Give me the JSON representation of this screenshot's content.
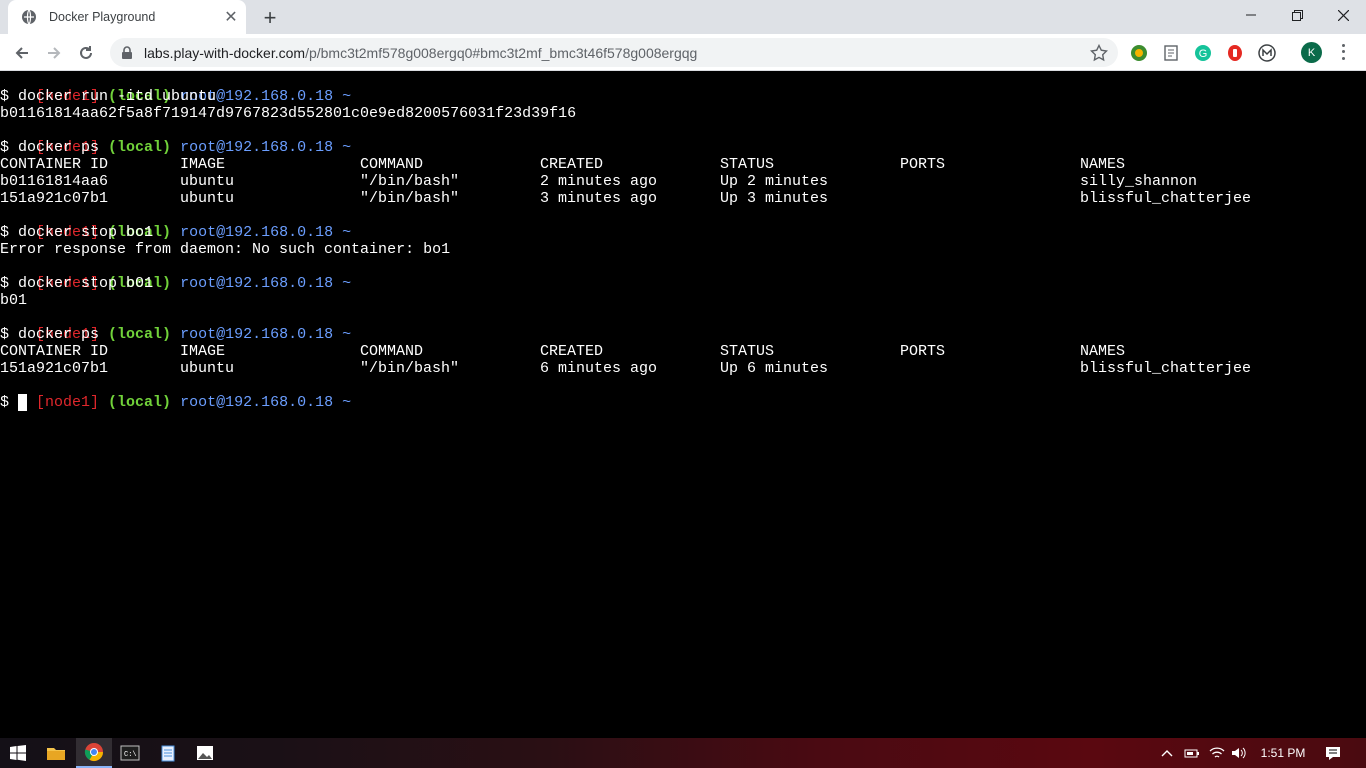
{
  "browser": {
    "tab_title": "Docker Playground",
    "tab_close": "✕",
    "new_tab": "+",
    "url_host": "labs.play-with-docker.com",
    "url_path": "/p/bmc3t2mf578g008ergq0#bmc3t2mf_bmc3t46f578g008ergqg",
    "profile_initial": "K",
    "icons": [
      "globe-icon",
      "back-icon",
      "forward-icon",
      "reload-icon",
      "lock-icon",
      "star-icon",
      "minimize-icon",
      "maximize-icon",
      "close-icon"
    ]
  },
  "terminal": {
    "prompt": {
      "node": "[node1]",
      "local": "(local)",
      "host": "root@192.168.0.18",
      "tilde": "~"
    },
    "commands": {
      "run": "$ docker run -itd ubuntu",
      "ps1": "$ docker ps",
      "stop_bo1": "$ docker stop bo1",
      "stop_b01": "$ docker stop b01",
      "ps2": "$ docker ps",
      "current": "$ "
    },
    "outputs": {
      "container_hash": "b01161814aa62f5a8f719147d9767823d552801c0e9ed8200576031f23d39f16",
      "error": "Error response from daemon: No such container: bo1",
      "stopped": "b01"
    },
    "table_headers": [
      "CONTAINER ID",
      "IMAGE",
      "COMMAND",
      "CREATED",
      "STATUS",
      "PORTS",
      "NAMES"
    ],
    "ps1_rows": [
      [
        "b01161814aa6",
        "ubuntu",
        "\"/bin/bash\"",
        "2 minutes ago",
        "Up 2 minutes",
        "",
        "silly_shannon"
      ],
      [
        "151a921c07b1",
        "ubuntu",
        "\"/bin/bash\"",
        "3 minutes ago",
        "Up 3 minutes",
        "",
        "blissful_chatterjee"
      ]
    ],
    "ps2_rows": [
      [
        "151a921c07b1",
        "ubuntu",
        "\"/bin/bash\"",
        "6 minutes ago",
        "Up 6 minutes",
        "",
        "blissful_chatterjee"
      ]
    ]
  },
  "taskbar": {
    "clock": "1:51 PM",
    "colors": {
      "accent": "#8ab4f8"
    }
  }
}
